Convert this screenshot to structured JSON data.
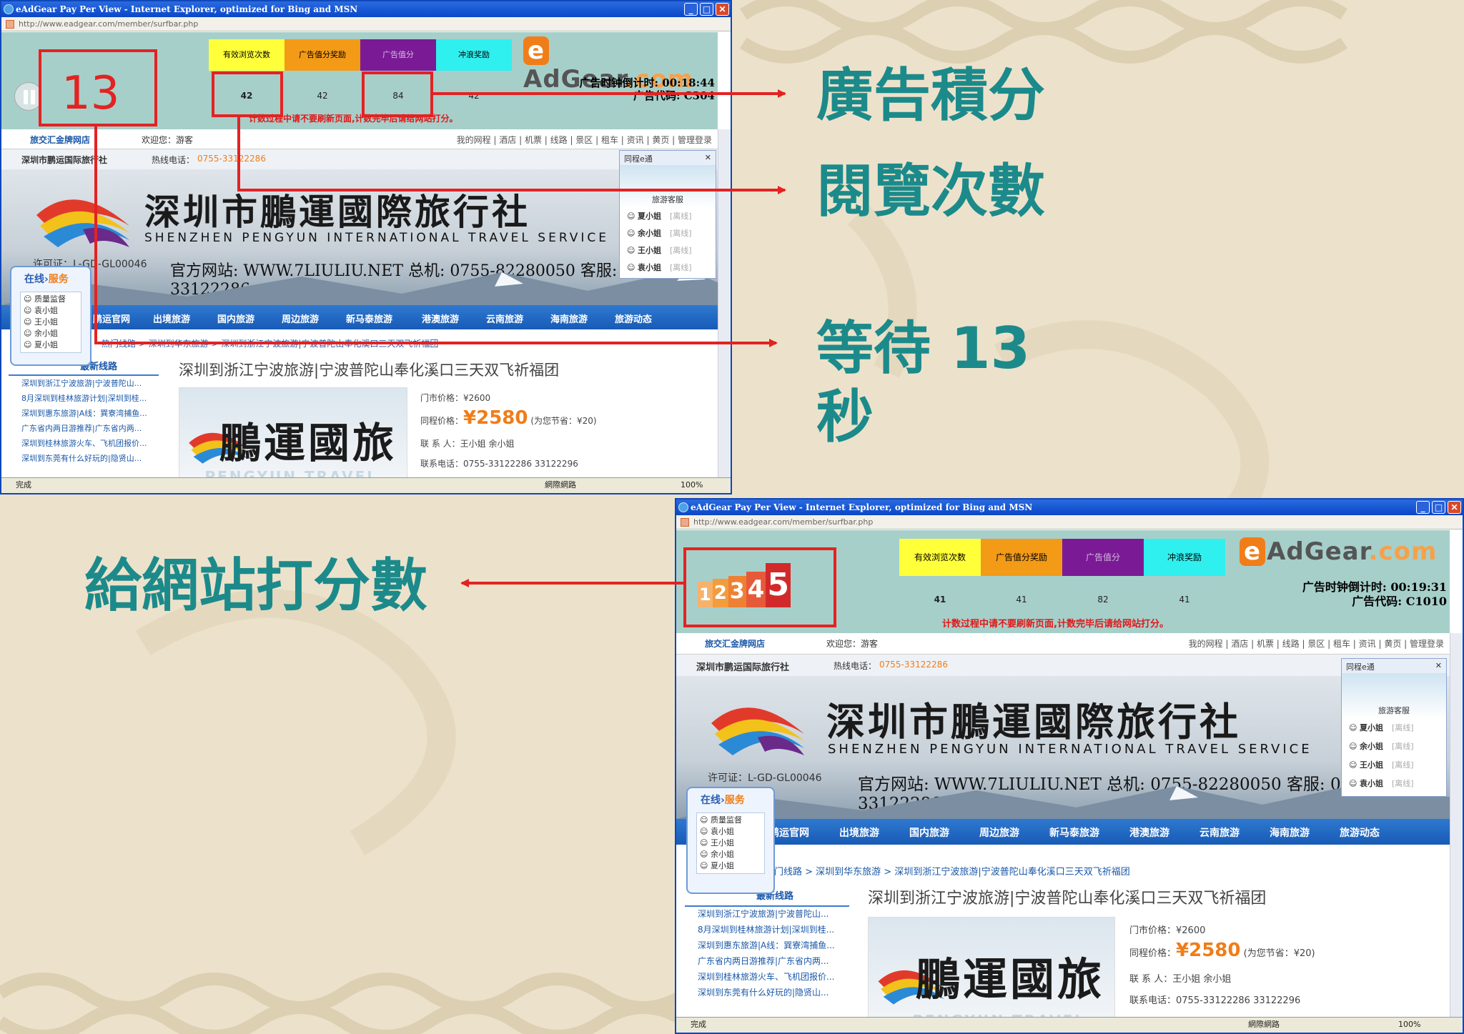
{
  "captions": {
    "ad_points": "廣告積分",
    "view_count": "閱覽次數",
    "wait": "等待 13\n秒",
    "rate_site": "給網站打分數"
  },
  "countdown_value": "13",
  "window1": {
    "title": "eAdGear Pay Per View - Internet Explorer, optimized for Bing and MSN",
    "url": "http://www.eadgear.com/member/surfbar.php",
    "tabs": [
      "有效浏览次数",
      "广告值分奖励",
      "广告值分",
      "冲浪奖励"
    ],
    "counts": [
      "42",
      "42",
      "84",
      "42"
    ],
    "timer": "广告时钟倒计时: 00:18:44",
    "adcode": "广告代码: C304",
    "warning": "计数过程中请不要刷新页面,计数完毕后请给网站打分。",
    "status": "完成",
    "zone": "網際網路",
    "zoom": "100%"
  },
  "window2": {
    "title": "eAdGear Pay Per View - Internet Explorer, optimized for Bing and MSN",
    "url": "http://www.eadgear.com/member/surfbar.php",
    "tabs": [
      "有效浏览次数",
      "广告值分奖励",
      "广告值分",
      "冲浪奖励"
    ],
    "counts": [
      "41",
      "41",
      "82",
      "41"
    ],
    "timer": "广告时钟倒计时: 00:19:31",
    "adcode": "广告代码: C1010",
    "warning": "计数过程中请不要刷新页面,计数完毕后请给网站打分。",
    "rating_digits": [
      "1",
      "2",
      "3",
      "4",
      "5"
    ],
    "status": "完成",
    "zone": "網際網路",
    "zoom": "100%"
  },
  "logo": {
    "e": "e",
    "name": "AdGear",
    "com": ".com"
  },
  "site": {
    "brand": "旅交汇金牌网店",
    "welcome": "欢迎您：游客",
    "links": "我的网程 | 酒店 | 机票 | 线路 | 景区 | 租车 | 资讯 | 黄页 | 管理登录",
    "company": "深圳市鹏运国际旅行社",
    "hotline_label": "热线电话：",
    "hotline": "0755-33122286",
    "banner_title": "深圳市鵬運國際旅行社",
    "banner_english": "SHENZHEN PENGYUN INTERNATIONAL TRAVEL SERVICE",
    "license": "许可证：L-GD-GL00046",
    "official": "官方网站: WWW.7LIULIU.NET  总机: 0755-82280050 客服: 0755-33122286",
    "menu": [
      "鹏运官网",
      "出境旅游",
      "国内旅游",
      "周边旅游",
      "新马泰旅游",
      "港澳旅游",
      "云南旅游",
      "海南旅游",
      "旅游动态"
    ],
    "breadcrumb": "热门线路 > 深圳到华东旅游 > 深圳到浙江宁波旅游|宁波普陀山奉化溪口三天双飞祈福团",
    "sidebar_tabs": [
      "热门线路",
      "最新线路"
    ],
    "sidebar_items": [
      "深圳到浙江宁波旅游|宁波普陀山...",
      "8月深圳到桂林旅游计划|深圳到桂...",
      "深圳到惠东旅游|A线：巽寮湾捕鱼...",
      "广东省内两日游推荐|广东省内两...",
      "深圳到桂林旅游火车、飞机团报价...",
      "深圳到东莞有什么好玩的|隐贤山..."
    ],
    "product_title": "深圳到浙江宁波旅游|宁波普陀山奉化溪口三天双飞祈福团",
    "product_img_text": "鵬運國旅",
    "product_img_sub": "PENGYUN TRAVEL",
    "market_price": "门市价格：¥2600",
    "price_label": "同程价格：",
    "price": "¥2580",
    "save": "(为您节省：¥20)",
    "contact": "联 系 人：王小姐 余小姐",
    "phone": "联系电话：0755-33122286 33122296",
    "chat_title": "同程e通",
    "chat_role": "旅游客服",
    "chat_agents": [
      "夏小姐",
      "余小姐",
      "王小姐",
      "袁小姐"
    ],
    "chat_offline": "[离线]",
    "online_title_a": "在线",
    "online_title_b": "服务",
    "online_agents": [
      "质量监督",
      "袁小姐",
      "王小姐",
      "余小姐",
      "夏小姐"
    ]
  },
  "colors": {
    "teal_caption": "#1c8a8a",
    "red": "#e42222",
    "tab_colors": [
      "#ffff3a",
      "#f39a17",
      "#7a1b95",
      "#2ff0ef"
    ]
  }
}
